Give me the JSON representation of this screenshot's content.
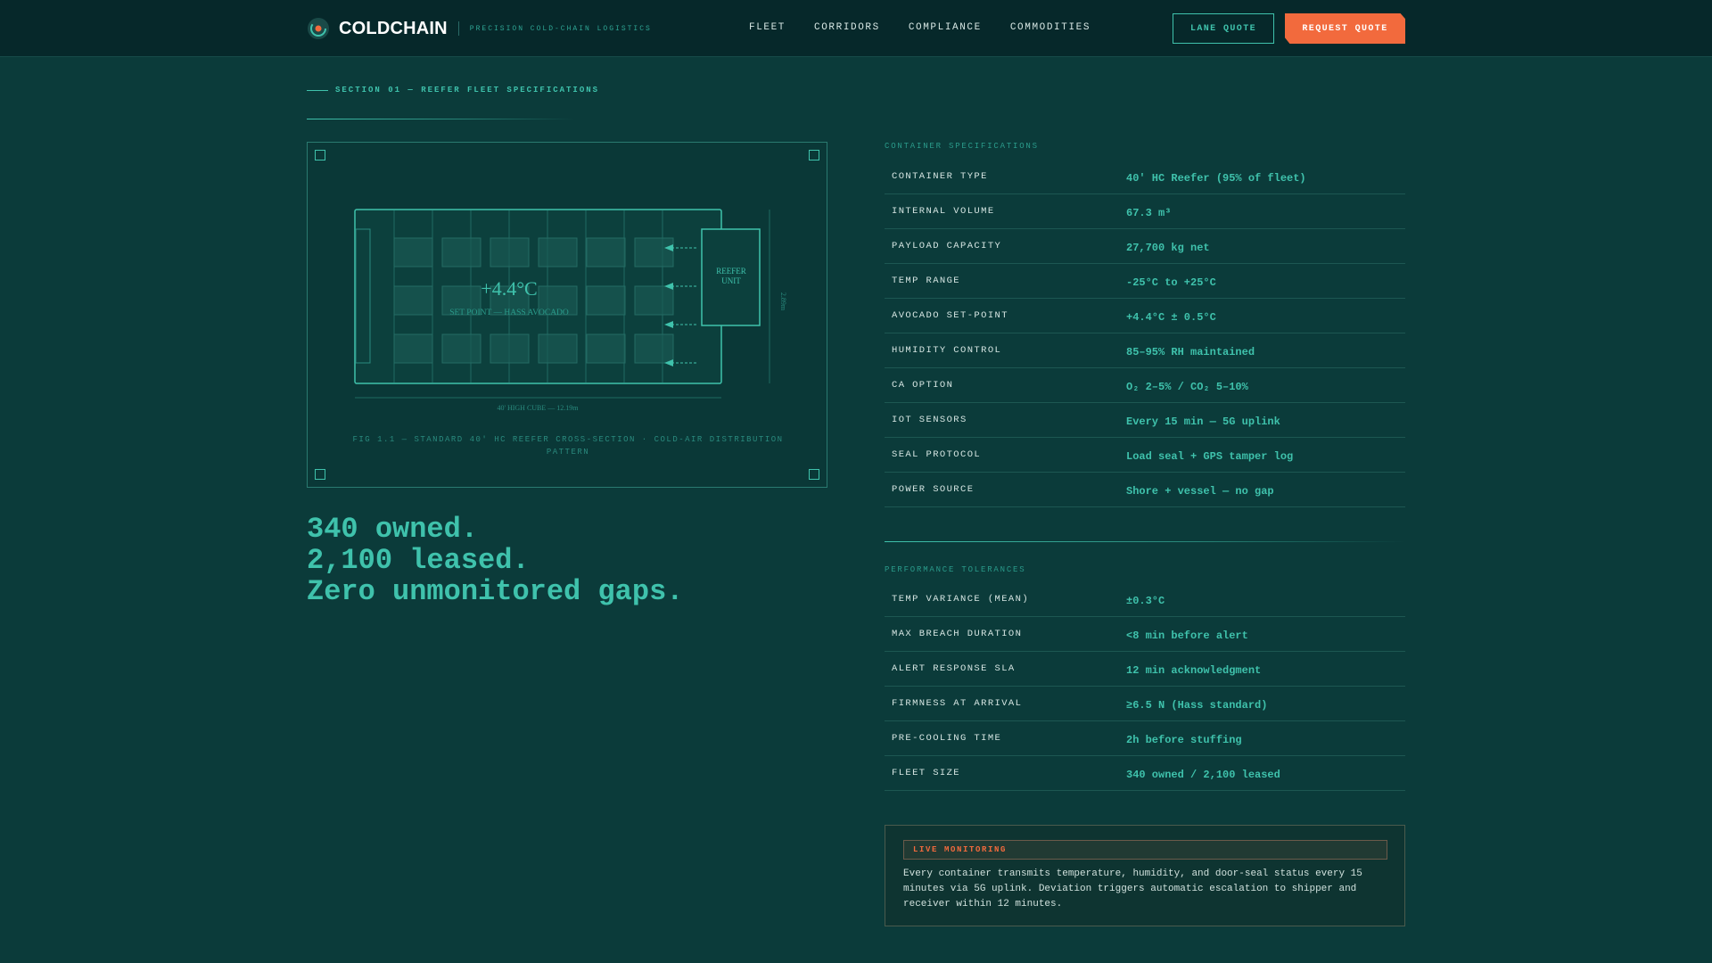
{
  "header": {
    "brand": "COLDCHAIN",
    "tagline": "PRECISION COLD-CHAIN LOGISTICS",
    "nav": [
      "FLEET",
      "CORRIDORS",
      "COMPLIANCE",
      "COMMODITIES"
    ],
    "lane_quote": "LANE QUOTE",
    "request_quote": "REQUEST QUOTE"
  },
  "section": {
    "label": "SECTION 01 — REEFER FLEET SPECIFICATIONS"
  },
  "figure": {
    "temperature": "+4.4°C",
    "set_point": "SET POINT — HASS AVOCADO",
    "reefer_unit_line1": "REEFER",
    "reefer_unit_line2": "UNIT",
    "length_label": "40' HIGH CUBE — 12.19m",
    "height_label": "2.89m",
    "caption": "FIG 1.1 — STANDARD 40' HC REEFER CROSS-SECTION · COLD-AIR DISTRIBUTION PATTERN"
  },
  "headline": {
    "line1": "340 owned.",
    "line2": "2,100 leased.",
    "line3": "Zero unmonitored gaps."
  },
  "container_specs": {
    "title": "CONTAINER SPECIFICATIONS",
    "rows": [
      {
        "key": "CONTAINER TYPE",
        "value": "40' HC Reefer (95% of fleet)"
      },
      {
        "key": "INTERNAL VOLUME",
        "value": "67.3 m³"
      },
      {
        "key": "PAYLOAD CAPACITY",
        "value": "27,700 kg net"
      },
      {
        "key": "TEMP RANGE",
        "value": "-25°C to +25°C"
      },
      {
        "key": "AVOCADO SET-POINT",
        "value": "+4.4°C ± 0.5°C"
      },
      {
        "key": "HUMIDITY CONTROL",
        "value": "85–95% RH maintained"
      },
      {
        "key": "CA OPTION",
        "value": "O₂ 2–5% / CO₂ 5–10%"
      },
      {
        "key": "IOT SENSORS",
        "value": "Every 15 min — 5G uplink"
      },
      {
        "key": "SEAL PROTOCOL",
        "value": "Load seal + GPS tamper log"
      },
      {
        "key": "POWER SOURCE",
        "value": "Shore + vessel — no gap"
      }
    ]
  },
  "performance": {
    "title": "PERFORMANCE TOLERANCES",
    "rows": [
      {
        "key": "TEMP VARIANCE (MEAN)",
        "value": "±0.3°C"
      },
      {
        "key": "MAX BREACH DURATION",
        "value": "<8 min before alert"
      },
      {
        "key": "ALERT RESPONSE SLA",
        "value": "12 min acknowledgment"
      },
      {
        "key": "FIRMNESS AT ARRIVAL",
        "value": "≥6.5 N (Hass standard)"
      },
      {
        "key": "PRE-COOLING TIME",
        "value": "2h before stuffing"
      },
      {
        "key": "FLEET SIZE",
        "value": "340 owned / 2,100 leased"
      }
    ]
  },
  "live": {
    "badge": "LIVE MONITORING",
    "text": "Every container transmits temperature, humidity, and door-seal status every 15 minutes via 5G uplink. Deviation triggers automatic escalation to shipper and receiver within 12 minutes."
  },
  "colors": {
    "background": "#0b3b3a",
    "accent": "#3fc2ac",
    "cta": "#f26a3d"
  }
}
